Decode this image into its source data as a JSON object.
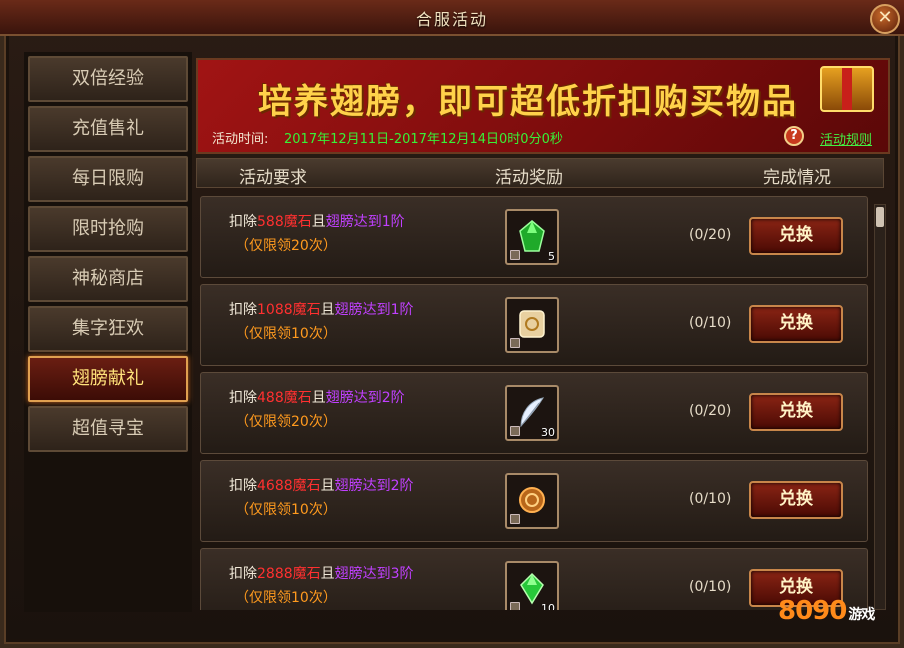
{
  "window": {
    "title": "合服活动",
    "close_label": "✕"
  },
  "sidebar": {
    "items": [
      {
        "label": "双倍经验",
        "active": false
      },
      {
        "label": "充值售礼",
        "active": false
      },
      {
        "label": "每日限购",
        "active": false
      },
      {
        "label": "限时抢购",
        "active": false
      },
      {
        "label": "神秘商店",
        "active": false
      },
      {
        "label": "集字狂欢",
        "active": false
      },
      {
        "label": "翅膀献礼",
        "active": true
      },
      {
        "label": "超值寻宝",
        "active": false
      }
    ]
  },
  "banner": {
    "title": "培养翅膀，即可超低折扣购买物品",
    "time_label": "活动时间:",
    "time_value": "2017年12月11日-2017年12月14日0时0分0秒",
    "help_icon": "question-icon",
    "rules_link": "活动规则"
  },
  "table": {
    "headers": [
      "活动要求",
      "活动奖励",
      "完成情况"
    ],
    "rows": [
      {
        "prefix": "扣除",
        "amount": "588",
        "currency": "魔石",
        "joiner": "且",
        "condition": "翅膀达到1阶",
        "limit": "（仅限领20次）",
        "item_icon": "green-gem-icon",
        "item_count": "5",
        "progress": "(0/20)",
        "button": "兑换"
      },
      {
        "prefix": "扣除",
        "amount": "1088",
        "currency": "魔石",
        "joiner": "且",
        "condition": "翅膀达到1阶",
        "limit": "（仅限领10次）",
        "item_icon": "scroll-icon",
        "item_count": "",
        "progress": "(0/10)",
        "button": "兑换"
      },
      {
        "prefix": "扣除",
        "amount": "488",
        "currency": "魔石",
        "joiner": "且",
        "condition": "翅膀达到2阶",
        "limit": "（仅限领20次）",
        "item_icon": "feather-icon",
        "item_count": "30",
        "progress": "(0/20)",
        "button": "兑换"
      },
      {
        "prefix": "扣除",
        "amount": "4688",
        "currency": "魔石",
        "joiner": "且",
        "condition": "翅膀达到2阶",
        "limit": "（仅限领10次）",
        "item_icon": "medal-icon",
        "item_count": "",
        "progress": "(0/10)",
        "button": "兑换"
      },
      {
        "prefix": "扣除",
        "amount": "2888",
        "currency": "魔石",
        "joiner": "且",
        "condition": "翅膀达到3阶",
        "limit": "（仅限领10次）",
        "item_icon": "green-gem-icon",
        "item_count": "10",
        "progress": "(0/10)",
        "button": "兑换"
      }
    ]
  },
  "watermark": {
    "brand": "8090",
    "suffix": "游戏"
  },
  "colors": {
    "accent_red": "#ff3030",
    "accent_purple": "#c040ff",
    "accent_orange": "#ff9a1e",
    "time_green": "#38f038",
    "active_tab_text": "#ffe27a"
  }
}
